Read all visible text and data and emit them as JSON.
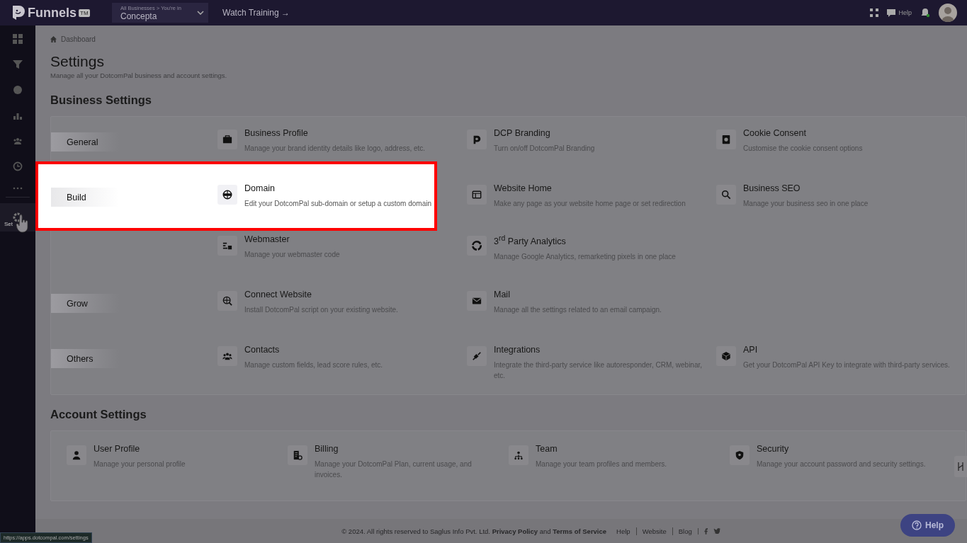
{
  "topbar": {
    "logo_text": "Funnels",
    "logo_badge": "TM",
    "business_switcher": {
      "caption": "All Businesses > You're in",
      "value": "Concepta"
    },
    "watch_training": "Watch Training →",
    "help": "Help"
  },
  "sidebar": {
    "settings_label": "Set"
  },
  "breadcrumb": "Dashboard",
  "page": {
    "title": "Settings",
    "subtitle": "Manage all your DotcomPal business and account settings."
  },
  "business_settings": {
    "heading": "Business Settings",
    "groups": [
      {
        "label": "General",
        "spotlight": false,
        "items": [
          {
            "title": "Business Profile",
            "description": "Manage your brand identity details like logo, address, etc."
          },
          {
            "title": "DCP Branding",
            "description": "Turn on/off DotcomPal Branding"
          },
          {
            "title": "Cookie Consent",
            "description": "Customise the cookie consent options"
          }
        ]
      },
      {
        "label": "Build",
        "spotlight": true,
        "items": [
          {
            "title": "Domain",
            "description": "Edit your DotcomPal sub-domain or setup a custom domain"
          },
          {
            "title": "Website Home",
            "description": "Make any page as your website home page or set redirection"
          },
          {
            "title": "Business SEO",
            "description": "Manage your business seo in one place"
          },
          {
            "title": "Webmaster",
            "description": "Manage your webmaster code"
          },
          {
            "title": "3$^{rd}$ Party Analytics",
            "description": "Manage Google Analytics, remarketing pixels in one place"
          }
        ]
      },
      {
        "label": "Grow",
        "spotlight": false,
        "items": [
          {
            "title": "Connect Website",
            "description": "Install DotcomPal script on your existing website."
          },
          {
            "title": "Mail",
            "description": "Manage all the settings related to an email campaign."
          }
        ]
      },
      {
        "label": "Others",
        "spotlight": false,
        "items": [
          {
            "title": "Contacts",
            "description": "Manage custom fields, lead score rules, etc."
          },
          {
            "title": "Integrations",
            "description": "Integrate the third-party service like autoresponder, CRM, webinar, etc."
          },
          {
            "title": "API",
            "description": "Get your DotcomPal API Key to integrate with third-party services."
          }
        ]
      }
    ]
  },
  "account_settings": {
    "heading": "Account Settings",
    "items": [
      {
        "title": "User Profile",
        "description": "Manage your personal profile"
      },
      {
        "title": "Billing",
        "description": "Manage your DotcomPal Plan, current usage, and invoices."
      },
      {
        "title": "Team",
        "description": "Manage your team profiles and members."
      },
      {
        "title": "Security",
        "description": "Manage your account password and security settings."
      }
    ]
  },
  "footer": {
    "copyright": "©  2024. All rights reserved to Saglus Info Pvt. Ltd. **Privacy Policy** and **Terms of Service**",
    "links": [
      "Help",
      "Website",
      "Blog"
    ]
  },
  "help_button": "Help",
  "status_url": "https://apps.dotcompal.com/settings"
}
